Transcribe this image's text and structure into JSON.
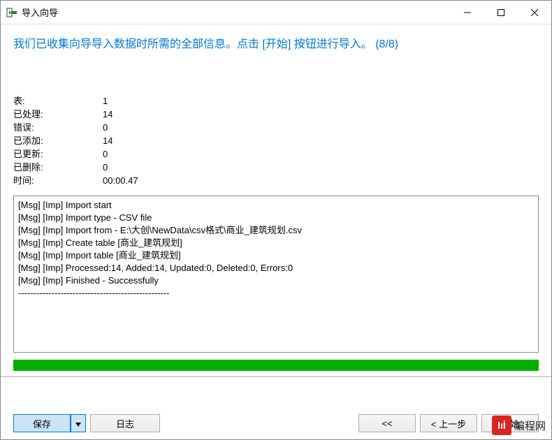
{
  "window": {
    "title": "导入向导"
  },
  "heading": "我们已收集向导导入数据时所需的全部信息。点击 [开始] 按钮进行导入。  (8/8)",
  "stats": [
    {
      "label": "表:",
      "value": "1"
    },
    {
      "label": "已处理:",
      "value": "14"
    },
    {
      "label": "错误:",
      "value": "0"
    },
    {
      "label": "已添加:",
      "value": "14"
    },
    {
      "label": "已更新:",
      "value": "0"
    },
    {
      "label": "已删除:",
      "value": "0"
    },
    {
      "label": "时间:",
      "value": "00:00.47"
    }
  ],
  "log": [
    "[Msg] [Imp] Import start",
    "[Msg] [Imp] Import type - CSV file",
    "[Msg] [Imp] Import from - E:\\大创\\NewData\\csv格式\\商业_建筑规划.csv",
    "[Msg] [Imp] Create table [商业_建筑规划]",
    "[Msg] [Imp] Import table [商业_建筑规划]",
    "[Msg] [Imp] Processed:14, Added:14, Updated:0, Deleted:0, Errors:0",
    "[Msg] [Imp] Finished - Successfully",
    "--------------------------------------------------"
  ],
  "buttons": {
    "save": "保存",
    "log": "日志",
    "first": "<<",
    "prev": "< 上一步",
    "start": "开始"
  },
  "watermark": {
    "logo": "lıİ",
    "text": "编程网"
  }
}
